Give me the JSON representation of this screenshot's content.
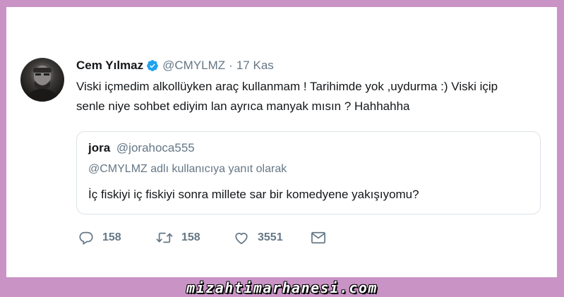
{
  "tweet": {
    "author_name": "Cem Yılmaz",
    "handle": "@CMYLMZ",
    "separator": "·",
    "date": "17 Kas",
    "text_line1": "Viski içmedim alkollüyken araç kullanmam ! Tarihimde yok ,uydurma :) Viski içip",
    "text_line2": "senle niye sohbet ediyim lan ayrıca manyak mısın ? Hahhahha"
  },
  "quoted_tweet": {
    "author_name": "jora",
    "handle": "@jorahoca555",
    "reply_context": "@CMYLMZ adlı kullanıcıya yanıt olarak",
    "text": "İç fiskiyi iç fiskiyi sonra millete sar bir komedyene yakışıyomu?"
  },
  "actions": {
    "reply_count": "158",
    "retweet_count": "158",
    "like_count": "3551"
  },
  "watermark": "mizahtimarhanesi.com",
  "colors": {
    "background_border": "#c993c6",
    "verified_badge": "#1da1f2",
    "secondary_text": "#657786",
    "primary_text": "#14171a"
  },
  "icons": [
    "verified-badge-icon",
    "reply-icon",
    "retweet-icon",
    "like-icon",
    "message-icon"
  ]
}
